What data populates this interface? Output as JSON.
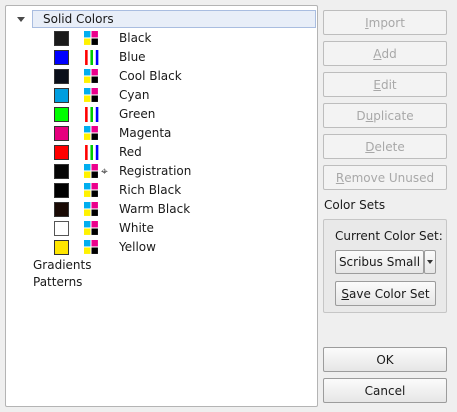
{
  "tree": {
    "root_label": "Solid Colors",
    "colors": [
      {
        "name": "Black",
        "swatch": "#1a1a1a",
        "space": "cmyk",
        "registration": false
      },
      {
        "name": "Blue",
        "swatch": "#0000ff",
        "space": "rgb",
        "registration": false
      },
      {
        "name": "Cool Black",
        "swatch": "#0a0f1a",
        "space": "cmyk",
        "registration": false
      },
      {
        "name": "Cyan",
        "swatch": "#009ee0",
        "space": "cmyk",
        "registration": false
      },
      {
        "name": "Green",
        "swatch": "#00ff00",
        "space": "rgb",
        "registration": false
      },
      {
        "name": "Magenta",
        "swatch": "#e6007e",
        "space": "cmyk",
        "registration": false
      },
      {
        "name": "Red",
        "swatch": "#ff0000",
        "space": "rgb",
        "registration": false
      },
      {
        "name": "Registration",
        "swatch": "#050505",
        "space": "cmyk",
        "registration": true
      },
      {
        "name": "Rich Black",
        "swatch": "#000000",
        "space": "cmyk",
        "registration": false
      },
      {
        "name": "Warm Black",
        "swatch": "#1a0a05",
        "space": "cmyk",
        "registration": false
      },
      {
        "name": "White",
        "swatch": "#ffffff",
        "space": "cmyk",
        "registration": false
      },
      {
        "name": "Yellow",
        "swatch": "#ffe600",
        "space": "cmyk",
        "registration": false
      }
    ],
    "categories": [
      "Gradients",
      "Patterns"
    ]
  },
  "buttons": {
    "import": {
      "pre": "",
      "u": "I",
      "post": "mport"
    },
    "add": {
      "pre": "",
      "u": "A",
      "post": "dd"
    },
    "edit": {
      "pre": "",
      "u": "E",
      "post": "dit"
    },
    "duplicate": {
      "pre": "D",
      "u": "u",
      "post": "plicate"
    },
    "delete": {
      "pre": "",
      "u": "D",
      "post": "elete"
    },
    "remove_unused": {
      "pre": "",
      "u": "R",
      "post": "emove Unused"
    },
    "save_color_set": {
      "pre": "",
      "u": "S",
      "post": "ave Color Set"
    },
    "ok": "OK",
    "cancel": "Cancel"
  },
  "color_sets": {
    "title": "Color Sets",
    "current_label": "Current Color Set:",
    "current_value": "Scribus Small"
  }
}
